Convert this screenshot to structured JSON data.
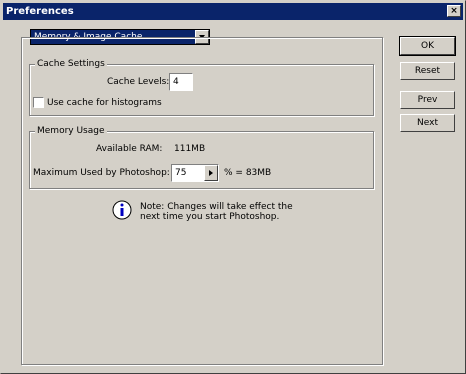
{
  "window": {
    "title": "Preferences",
    "close_glyph": "×"
  },
  "section_select": {
    "value": "Memory & Image Cache"
  },
  "cache": {
    "legend": "Cache Settings",
    "levels_label": "Cache Levels:",
    "levels_value": "4",
    "histogram_label": "Use cache for histograms",
    "histogram_checked": false
  },
  "memory": {
    "legend": "Memory Usage",
    "available_label": "Available RAM:",
    "available_value": "111MB",
    "max_label": "Maximum Used by Photoshop:",
    "max_value": "75",
    "max_suffix": "% = 83MB"
  },
  "note": {
    "text_line1": "Note: Changes will take effect the",
    "text_line2": "next time you start Photoshop."
  },
  "buttons": {
    "ok": "OK",
    "reset": "Reset",
    "prev": "Prev",
    "next": "Next"
  },
  "icons": {
    "info": "info-icon",
    "dropdown": "chevron-down-icon",
    "spinner": "triangle-right-icon"
  }
}
